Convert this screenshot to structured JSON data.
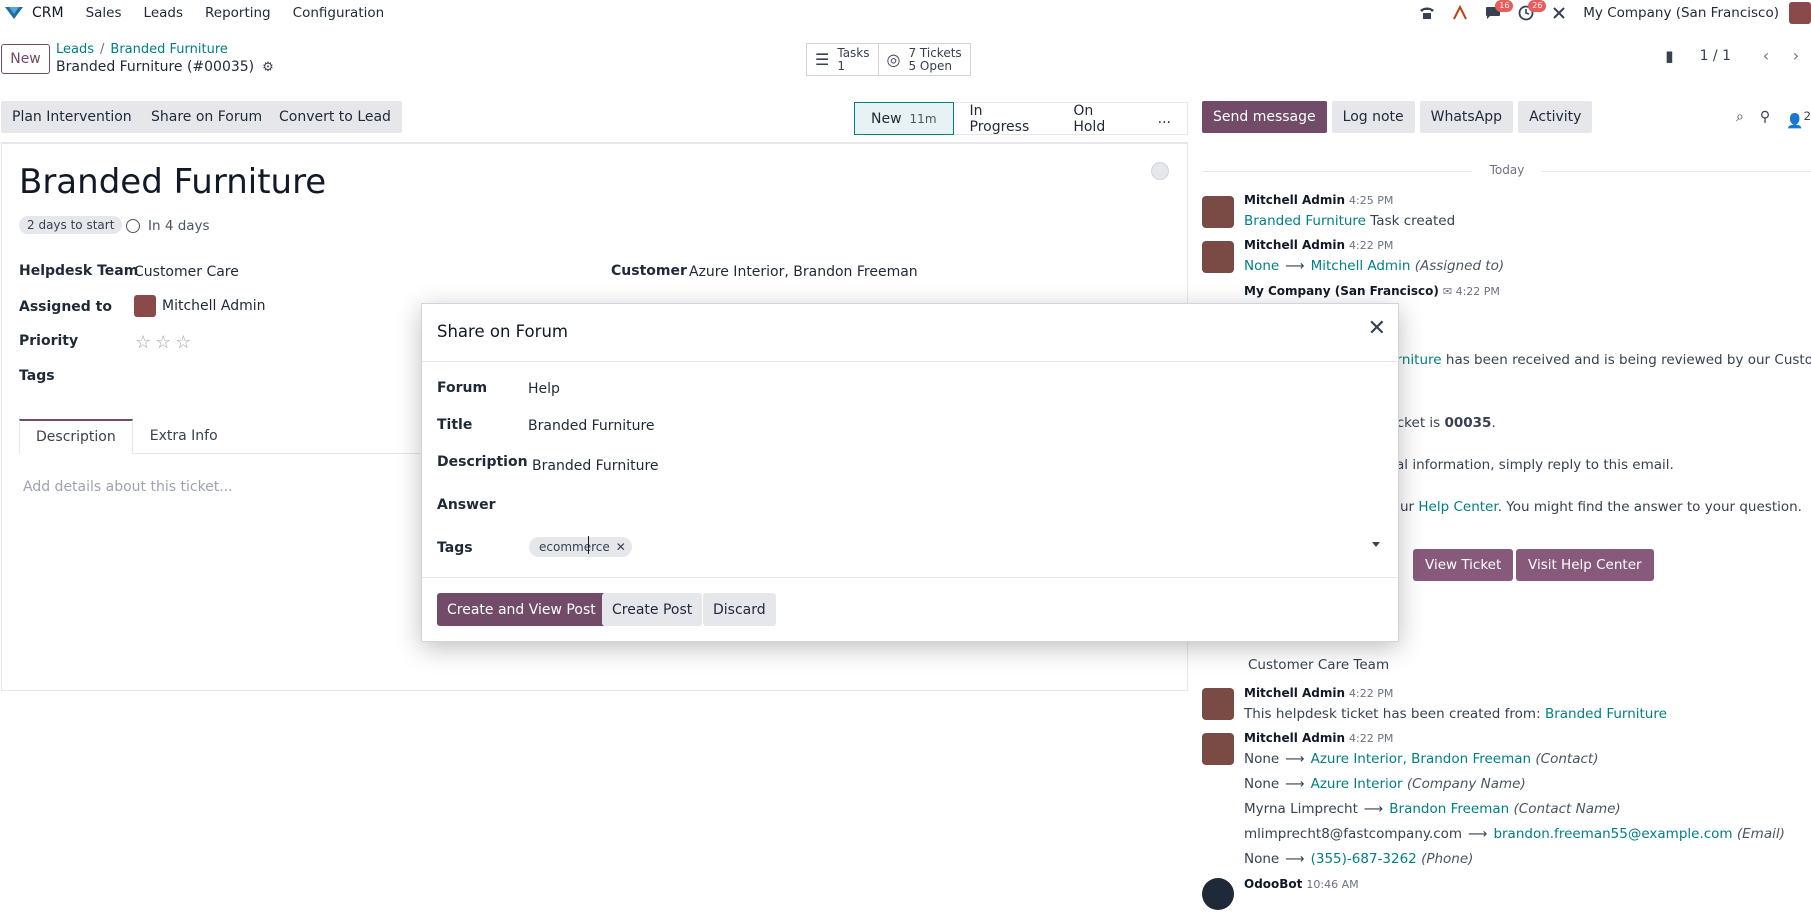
{
  "navbar": {
    "app_name": "CRM",
    "menu": [
      "Sales",
      "Leads",
      "Reporting",
      "Configuration"
    ],
    "chat_badge": "16",
    "activity_badge": "26",
    "company": "My Company (San Francisco)"
  },
  "control_panel": {
    "new_label": "New",
    "breadcrumb": [
      "Leads",
      "Branded Furniture"
    ],
    "record_name": "Branded Furniture (#00035)",
    "smart_buttons": [
      {
        "line1": "Tasks",
        "line2": "1"
      },
      {
        "line1": "7 Tickets",
        "line2": "5 Open"
      }
    ],
    "pager": "1 / 1"
  },
  "actions": [
    "Plan Intervention",
    "Share on Forum",
    "Convert to Lead"
  ],
  "stages": [
    {
      "label": "New",
      "time": "11m"
    },
    {
      "label": "In Progress"
    },
    {
      "label": "On Hold"
    },
    {
      "label": "..."
    }
  ],
  "form": {
    "title": "Branded Furniture",
    "start_badge": "2 days to start",
    "deadline": "In 4 days",
    "helpdesk_team_label": "Helpdesk Team",
    "helpdesk_team": "Customer Care",
    "assigned_label": "Assigned to",
    "assigned": "Mitchell Admin",
    "priority_label": "Priority",
    "tags_label": "Tags",
    "customer_label": "Customer",
    "customer": "Azure Interior, Brandon Freeman",
    "tabs": [
      "Description",
      "Extra Info"
    ],
    "description_placeholder": "Add details about this ticket..."
  },
  "chatter": {
    "buttons": [
      "Send message",
      "Log note",
      "WhatsApp",
      "Activity"
    ],
    "followers": "2",
    "today": "Today",
    "msg1": {
      "author": "Mitchell Admin",
      "time": "4:25 PM",
      "link": "Branded Furniture",
      "text": "Task created"
    },
    "msg2": {
      "author": "Mitchell Admin",
      "time": "4:22 PM",
      "from": "None",
      "to": "Mitchell Admin",
      "field": "(Assigned to)"
    },
    "msg3": {
      "author": "My Company (San Francisco)",
      "time": "4:22 PM",
      "line1_link": "urniture",
      "line1_text": "has been received and is being reviewed by our Customer",
      "line2_text": "icket is",
      "line2_bold": "00035",
      "line3_text": "al information, simply reply to this email.",
      "line4_pre": "ur",
      "line4_link": "Help Center",
      "line4_post": ". You might find the answer to your question.",
      "btn_view": "View Ticket",
      "btn_help": "Visit Help Center",
      "signature": "Customer Care Team"
    },
    "msg4": {
      "author": "Mitchell Admin",
      "time": "4:22 PM",
      "text": "This helpdesk ticket has been created from:",
      "link": "Branded Furniture"
    },
    "msg5": {
      "author": "Mitchell Admin",
      "time": "4:22 PM",
      "changes": [
        {
          "from": "None",
          "to": "Azure Interior, Brandon Freeman",
          "field": "(Contact)"
        },
        {
          "from": "None",
          "to": "Azure Interior",
          "field": "(Company Name)"
        },
        {
          "from": "Myrna Limprecht",
          "to": "Brandon Freeman",
          "field": "(Contact Name)"
        },
        {
          "from": "mlimprecht8@fastcompany.com",
          "to": "brandon.freeman55@example.com",
          "field": "(Email)"
        },
        {
          "from": "None",
          "to": "(355)-687-3262",
          "field": "(Phone)"
        }
      ]
    },
    "msg6": {
      "author": "OdooBot",
      "time": "10:46 AM"
    }
  },
  "modal": {
    "title": "Share on Forum",
    "forum_label": "Forum",
    "forum": "Help",
    "title_label": "Title",
    "title_value": "Branded Furniture",
    "description_label": "Description",
    "description": "Branded Furniture",
    "answer_label": "Answer",
    "tags_label": "Tags",
    "tag": "ecommerce",
    "buttons": [
      "Create and View Post",
      "Create Post",
      "Discard"
    ]
  },
  "colors": {
    "primary": "#714b67",
    "link": "#017e84",
    "badge": "#ea5b5b"
  }
}
